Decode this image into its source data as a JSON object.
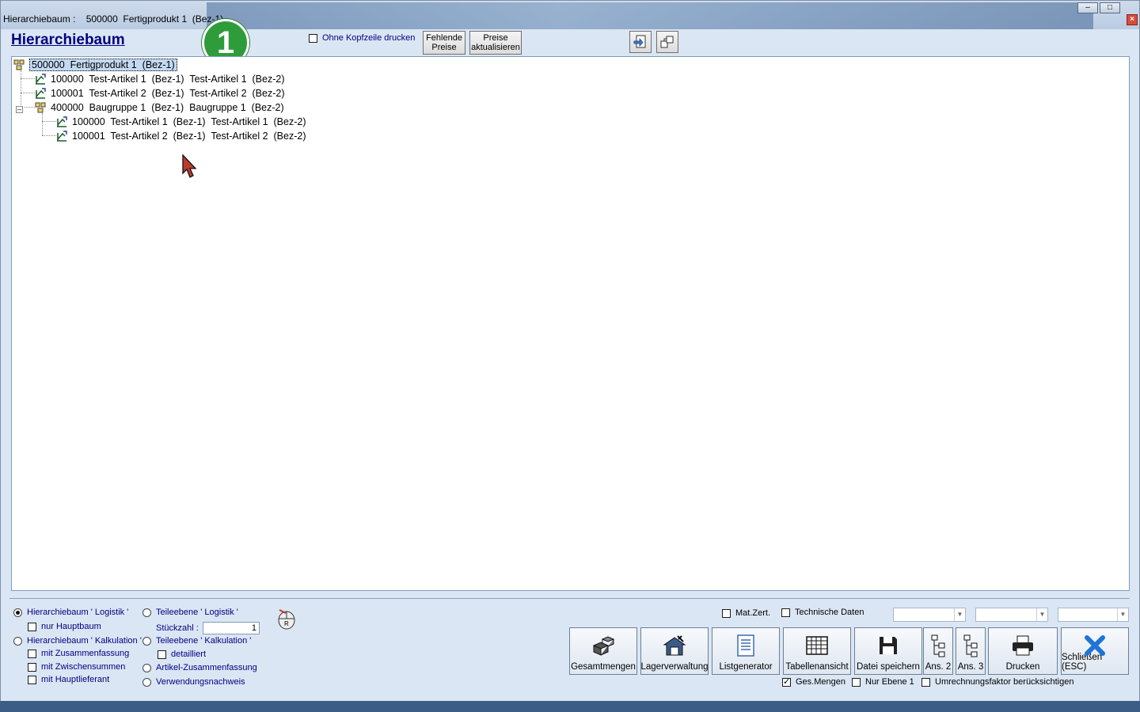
{
  "window": {
    "title": "Hierarchiebaum :    500000  Fertigprodukt 1  (Bez-1)",
    "close_label": "×"
  },
  "header": {
    "heading": "Hierarchiebaum",
    "badge": "1",
    "ohne_kopfzeile": "Ohne Kopfzeile drucken",
    "btn_fehlende_1": "Fehlende",
    "btn_fehlende_2": "Preise",
    "btn_preise_1": "Preise",
    "btn_preise_2": "aktualisieren"
  },
  "tree": {
    "root": "500000  Fertigprodukt 1  (Bez-1)",
    "items": [
      "100000  Test-Artikel 1  (Bez-1)  Test-Artikel 1  (Bez-2)",
      "100001  Test-Artikel 2  (Bez-1)  Test-Artikel 2  (Bez-2)",
      "400000  Baugruppe 1  (Bez-1)  Baugruppe 1  (Bez-2)",
      "100000  Test-Artikel 1  (Bez-1)  Test-Artikel 1  (Bez-2)",
      "100001  Test-Artikel 2  (Bez-1)  Test-Artikel 2  (Bez-2)"
    ]
  },
  "options": {
    "hb_logistik": "Hierarchiebaum ' Logistik '",
    "nur_hauptbaum": "nur Hauptbaum",
    "hb_kalkulation": "Hierarchiebaum ' Kalkulation '",
    "mit_zusammenfassung": "mit Zusammenfassung",
    "mit_zwischensummen": "mit Zwischensummen",
    "mit_hauptlieferant": "mit Hauptlieferant",
    "te_logistik": "Teileebene ' Logistik '",
    "stueckzahl_label": "Stückzahl :",
    "stueckzahl_value": "1",
    "te_kalkulation": "Teileebene ' Kalkulation '",
    "detailliert": "detailliert",
    "artikel_zusammenfassung": "Artikel-Zusammenfassung",
    "verwendungsnachweis": "Verwendungsnachweis"
  },
  "right": {
    "matzert": "Mat.Zert.",
    "techn": "Technische Daten",
    "ges_mengen": "Ges.Mengen",
    "nur_ebene": "Nur Ebene 1",
    "umrechnung": "Umrechnungsfaktor berücksichtigen"
  },
  "buttons": {
    "gesamtmengen": "Gesamtmengen",
    "lagerverwaltung": "Lagerverwaltung",
    "listgenerator": "Listgenerator",
    "tabellenansicht": "Tabellenansicht",
    "datei_speichern": "Datei speichern",
    "ans2": "Ans. 2",
    "ans3": "Ans. 3",
    "drucken": "Drucken",
    "schliessen": "Schließen (ESC)"
  },
  "colors": {
    "badge_green": "#2e9c3a",
    "link_blue": "#00007f",
    "close_blue": "#1f74d8"
  }
}
